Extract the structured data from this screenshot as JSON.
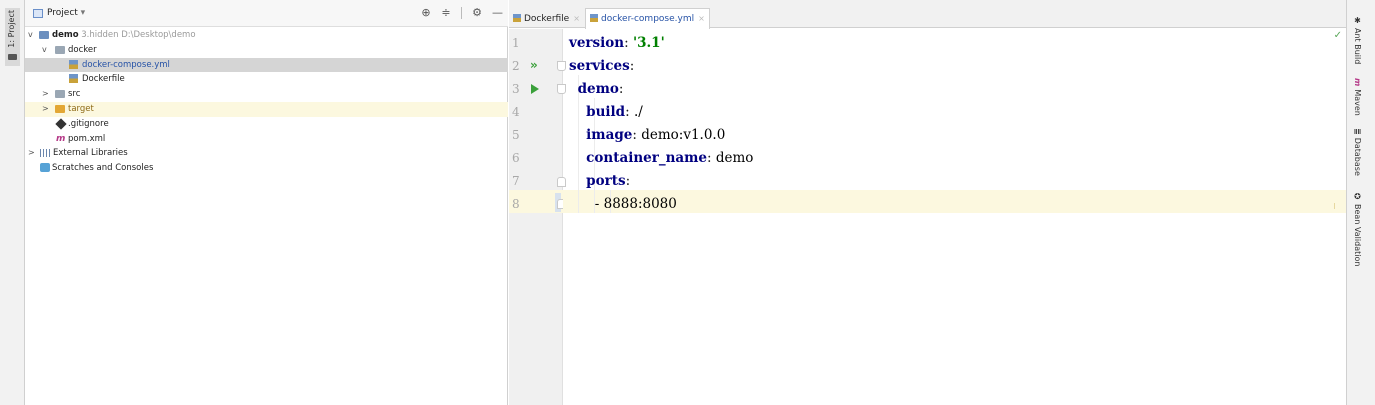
{
  "left_strip": {
    "project_tab": "1: Project"
  },
  "project_panel": {
    "title": "Project",
    "title_arrow": "▾",
    "tools": {
      "locate": "⊕",
      "collapse": "≑",
      "settings": "⚙",
      "hide": "—"
    },
    "tree": [
      {
        "arrow": "v",
        "label": "demo",
        "meta": "3.hidden",
        "path": "D:\\Desktop\\demo"
      },
      {
        "arrow": "v",
        "label": "docker"
      },
      {
        "label": "docker-compose.yml"
      },
      {
        "label": "Dockerfile"
      },
      {
        "arrow": ">",
        "label": "src"
      },
      {
        "arrow": ">",
        "label": "target"
      },
      {
        "label": ".gitignore"
      },
      {
        "icon_text": "m",
        "label": "pom.xml"
      },
      {
        "arrow": ">",
        "label": "External Libraries"
      },
      {
        "label": "Scratches and Consoles"
      }
    ]
  },
  "editor": {
    "tabs": [
      {
        "label": "Dockerfile",
        "close": "×"
      },
      {
        "label": "docker-compose.yml",
        "close": "×"
      }
    ],
    "line_numbers": [
      "1",
      "2",
      "3",
      "4",
      "5",
      "6",
      "7",
      "8"
    ],
    "lines": [
      {
        "key": "version",
        "sep": ": ",
        "value": "'3.1'"
      },
      {
        "key": "services",
        "sep": ":"
      },
      {
        "indent": "  ",
        "key": "demo",
        "sep": ":"
      },
      {
        "indent": "    ",
        "key": "build",
        "sep": ": ",
        "value": "./"
      },
      {
        "indent": "    ",
        "key": "image",
        "sep": ": ",
        "value": "demo:v1.0.0"
      },
      {
        "indent": "    ",
        "key": "container_name",
        "sep": ": ",
        "value": "demo"
      },
      {
        "indent": "    ",
        "key": "ports",
        "sep": ":"
      },
      {
        "indent": "      ",
        "key": "",
        "sep": "",
        "value": "- 8888:8080"
      }
    ],
    "run_icons": {
      "services": "»",
      "demo": "▶"
    },
    "inspection": "✓"
  },
  "right_strip": {
    "tabs": [
      {
        "icon": "✱",
        "label": "Ant Build"
      },
      {
        "icon": "m",
        "label": "Maven"
      },
      {
        "icon": "≣",
        "label": "Database"
      },
      {
        "icon": "✪",
        "label": "Bean Validation"
      }
    ]
  }
}
